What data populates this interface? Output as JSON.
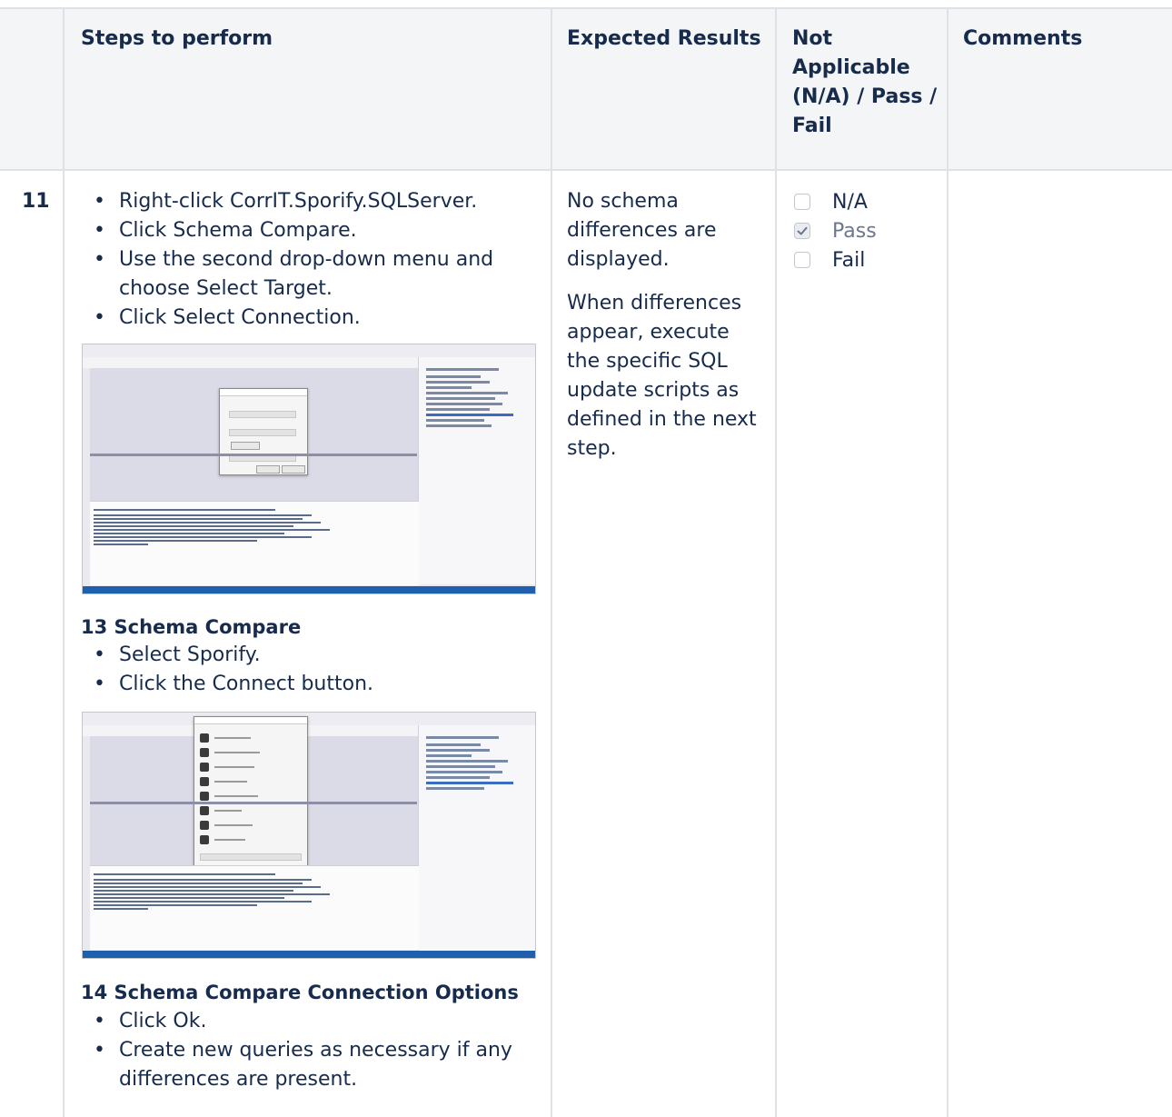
{
  "table": {
    "headers": {
      "steps": "Steps to perform",
      "expected": "Expected Results",
      "status": "Not Applicable (N/A) / Pass / Fail",
      "comments": "Comments"
    },
    "row": {
      "number": "11",
      "steps_intro": [
        "Right-click CorrIT.Sporify.SQLServer.",
        "Click Schema Compare.",
        "Use the second drop-down menu and choose Select Target.",
        "Click Select Connection."
      ],
      "section13_title": "13 Schema Compare",
      "section13_steps": [
        "Select Sporify.",
        "Click the Connect button."
      ],
      "section14_title": "14 Schema Compare Connection Options",
      "section14_steps": [
        "Click Ok.",
        "Create new queries as necessary if any differences are present."
      ],
      "expected_p1": "No schema differences are displayed.",
      "expected_p2": "When differences appear, execute the specific SQL update scripts as defined in the next step.",
      "status_options": [
        {
          "label": "N/A",
          "checked": false
        },
        {
          "label": "Pass",
          "checked": true
        },
        {
          "label": "Fail",
          "checked": false
        }
      ],
      "comments": ""
    }
  },
  "screenshots": {
    "shot1_label": "Select Target Schema dialog screenshot",
    "shot2_label": "Connect dialog screenshot"
  }
}
